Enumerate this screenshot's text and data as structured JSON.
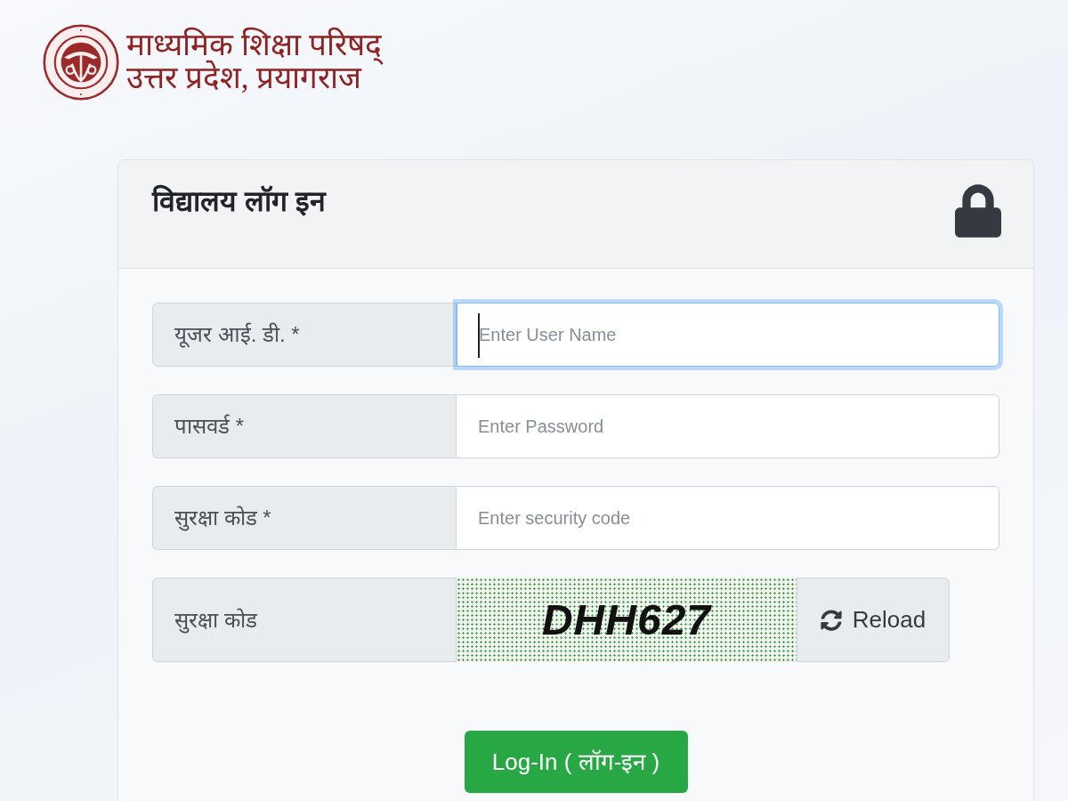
{
  "header": {
    "logo_line_1": "माध्यमिक शिक्षा परिषद्",
    "logo_line_2": "उत्तर प्रदेश, प्रयागराज"
  },
  "login_card": {
    "title": "विद्यालय लॉग इन",
    "fields": [
      {
        "label": "यूजर आई. डी. *",
        "placeholder": "Enter User Name",
        "focused": true
      },
      {
        "label": "पासवर्ड *",
        "placeholder": "Enter Password",
        "focused": false
      },
      {
        "label": "सुरक्षा कोड *",
        "placeholder": "Enter security code",
        "focused": false
      }
    ],
    "captcha": {
      "label": "सुरक्षा कोड",
      "code": "DHH627",
      "reload_button": "Reload"
    },
    "submit_button": "Log-In ( लॉग-इन )"
  }
}
